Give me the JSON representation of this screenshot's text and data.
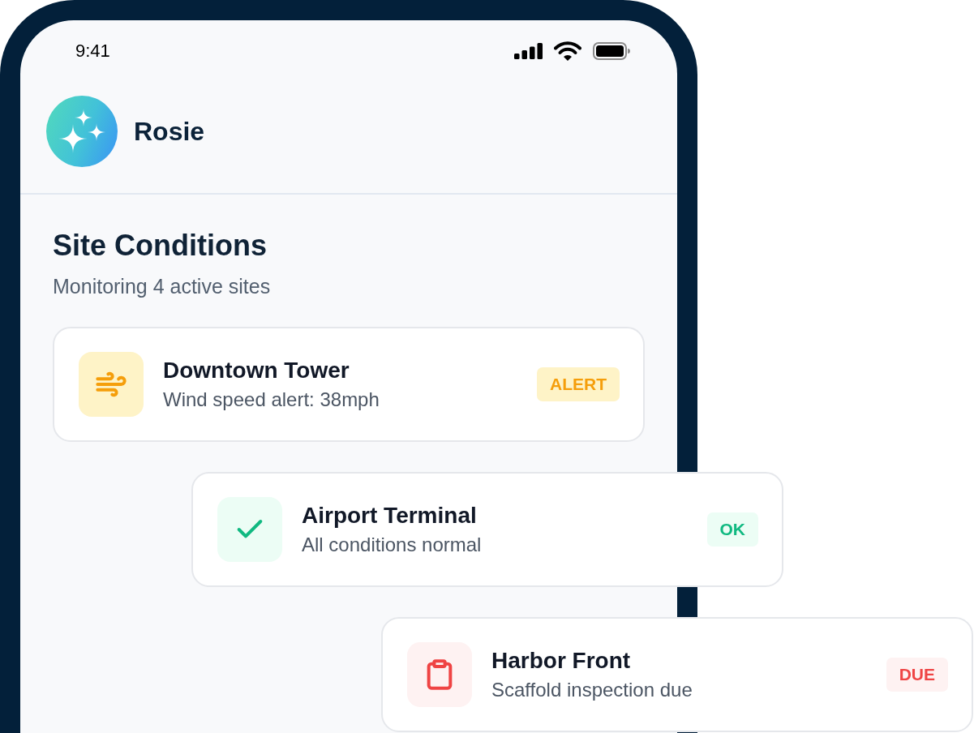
{
  "status_bar": {
    "time": "9:41"
  },
  "assistant": {
    "name": "Rosie"
  },
  "section": {
    "title": "Site Conditions",
    "subtitle": "Monitoring 4 active sites"
  },
  "sites": [
    {
      "name": "Downtown Tower",
      "detail": "Wind speed alert: 38mph",
      "status": "ALERT",
      "kind": "alert"
    },
    {
      "name": "Airport Terminal",
      "detail": "All conditions normal",
      "status": "OK",
      "kind": "ok"
    },
    {
      "name": "Harbor Front",
      "detail": "Scaffold inspection due",
      "status": "DUE",
      "kind": "due"
    }
  ]
}
